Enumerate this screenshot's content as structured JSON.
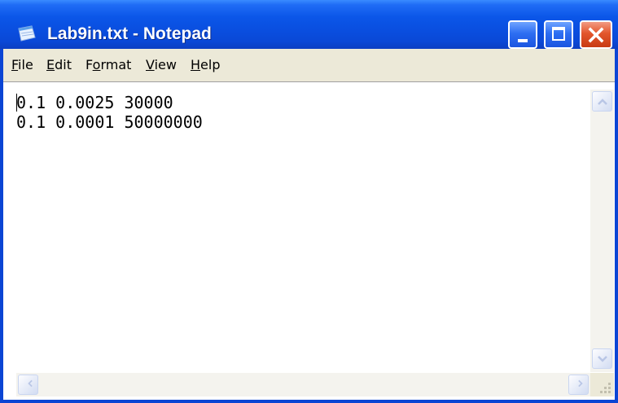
{
  "window": {
    "title": "Lab9in.txt - Notepad",
    "icon": "notepad-icon",
    "controls": [
      "minimize-icon",
      "maximize-icon",
      "close-icon"
    ]
  },
  "menu": {
    "file": {
      "accel": "F",
      "rest": "ile"
    },
    "edit": {
      "accel": "E",
      "rest": "dit"
    },
    "format": {
      "pre": "F",
      "accel": "o",
      "rest": "rmat"
    },
    "view": {
      "accel": "V",
      "rest": "iew"
    },
    "help": {
      "accel": "H",
      "rest": "elp"
    }
  },
  "editor": {
    "content": "0.1 0.0025 30000\n0.1 0.0001 50000000"
  },
  "scrollbars": {
    "vertical": [
      "arrow-up-icon",
      "arrow-down-icon"
    ],
    "horizontal": [
      "arrow-left-icon",
      "arrow-right-icon"
    ]
  },
  "colors": {
    "titlebar": "#0a4fe0",
    "menubar": "#ece9d8",
    "close_button": "#e3562c"
  }
}
